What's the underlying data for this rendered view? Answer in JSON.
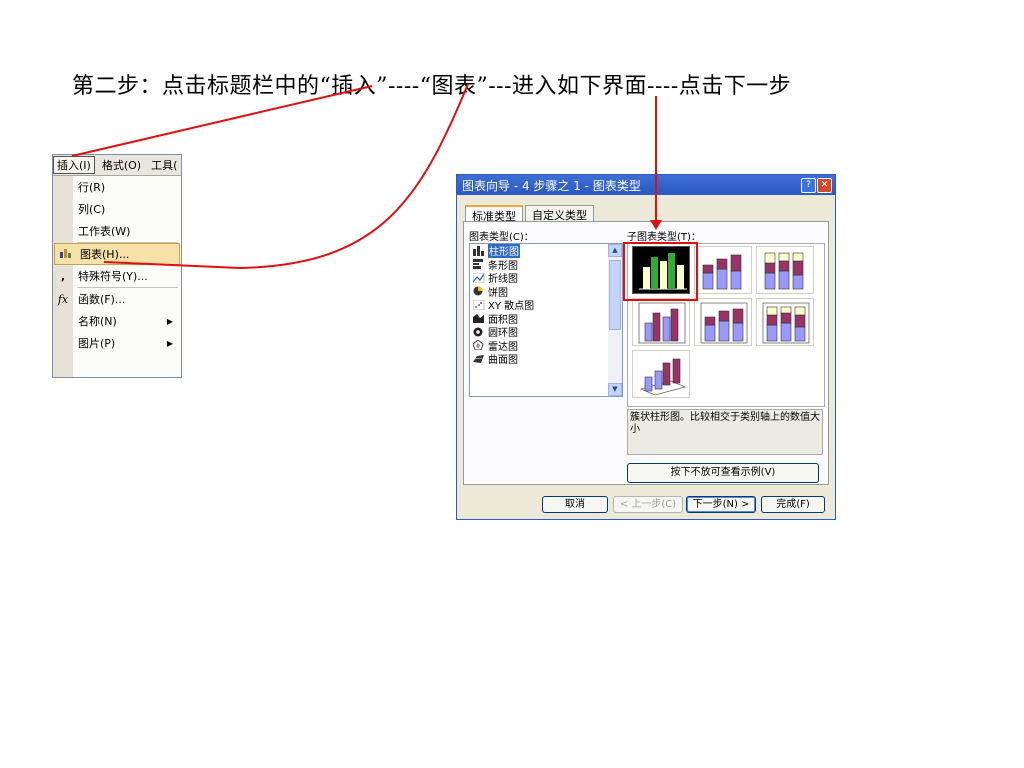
{
  "heading": "第二步：点击标题栏中的“插入”----“图表”---进入如下界面----点击下一步",
  "menu": {
    "menubar": [
      "插入(I)",
      "格式(O)",
      "工具("
    ],
    "items": [
      {
        "label": "行(R)",
        "icon": ""
      },
      {
        "label": "列(C)",
        "icon": ""
      },
      {
        "label": "工作表(W)",
        "icon": ""
      },
      {
        "label": "图表(H)...",
        "icon": "chart-icon"
      },
      {
        "label": "特殊符号(Y)...",
        "icon": "comma-icon"
      },
      {
        "label": "函数(F)...",
        "icon": "fx-icon"
      },
      {
        "label": "名称(N)",
        "icon": ""
      },
      {
        "label": "图片(P)",
        "icon": ""
      }
    ]
  },
  "dialog": {
    "title": "图表向导 - 4 步骤之 1 - 图表类型",
    "tabs": [
      "标准类型",
      "自定义类型"
    ],
    "chart_type_label": "图表类型(C)：",
    "subtype_label": "子图表类型(T)：",
    "chart_types": [
      "柱形图",
      "条形图",
      "折线图",
      "饼图",
      "XY 散点图",
      "面积图",
      "圆环图",
      "雷达图",
      "曲面图"
    ],
    "description": "簇状柱形图。比较相交于类别轴上的数值大小",
    "press_button": "按下不放可查看示例(V)",
    "buttons": {
      "cancel": "取消",
      "back": "< 上一步(C)",
      "next": "下一步(N) >",
      "finish": "完成(F)"
    }
  },
  "colors": {
    "highlight_red": "#e01010",
    "title_blue": "#2a58c0",
    "bar_purple": "#9999ff",
    "bar_maroon": "#993366",
    "bar_cream": "#ffffcc"
  }
}
